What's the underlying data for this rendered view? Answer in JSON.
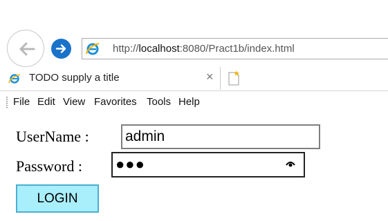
{
  "address_bar": {
    "url_prefix": "http://",
    "url_host": "localhost",
    "url_rest": ":8080/Pract1b/index.html"
  },
  "tab": {
    "title": "TODO supply a title",
    "close_glyph": "×"
  },
  "menu": {
    "items": [
      "File",
      "Edit",
      "View",
      "Favorites",
      "Tools",
      "Help"
    ]
  },
  "form": {
    "username_label": "UserName :",
    "username_value": "admin",
    "password_label": "Password :",
    "password_mask": "●●●",
    "login_label": "LOGIN"
  },
  "colors": {
    "forward_button": "#1a73c9",
    "login_button_bg": "#a9eefb",
    "login_button_border": "#4aaed1"
  }
}
